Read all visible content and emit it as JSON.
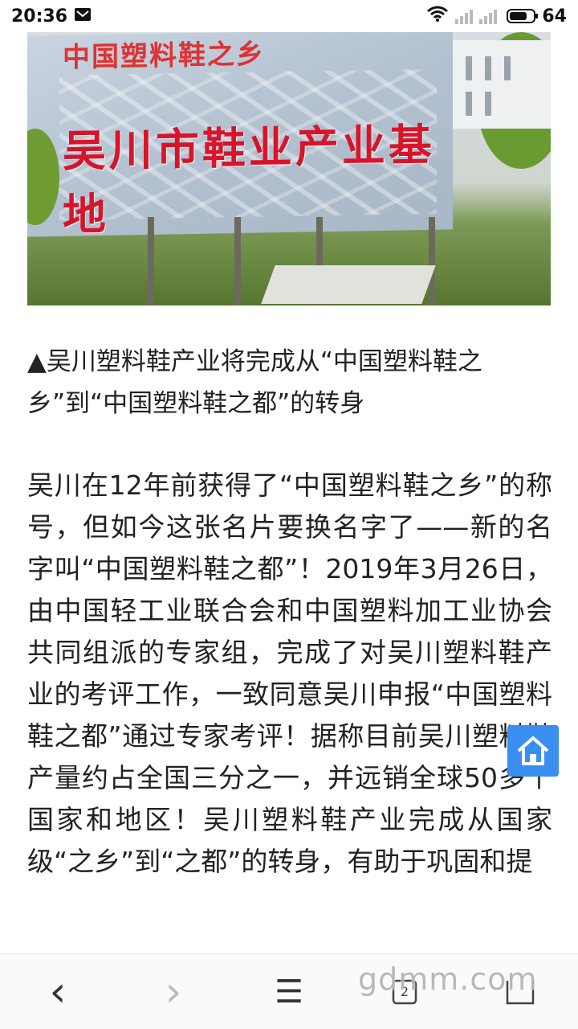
{
  "status_bar": {
    "time": "20:36",
    "battery": "64",
    "icons": [
      "message-icon",
      "wifi-icon",
      "signal-icon",
      "signal-icon",
      "battery-icon"
    ]
  },
  "photo": {
    "billboard_small": "中国塑料鞋之乡",
    "billboard_big": "吴川市鞋业产业基地"
  },
  "article": {
    "caption": "▲吴川塑料鞋产业将完成从“中国塑料鞋之乡”到“中国塑料鞋之都”的转身",
    "body": "吴川在12年前获得了“中国塑料鞋之乡”的称号，但如今这张名片要换名字了——新的名字叫“中国塑料鞋之都”！2019年3月26日，由中国轻工业联合会和中国塑料加工业协会共同组派的专家组，完成了对吴川塑料鞋产业的考评工作，一致同意吴川申报“中国塑料鞋之都”通过专家考评！据称目前吴川塑料鞋产量约占全国三分之一，并远销全球50多个国家和地区！吴川塑料鞋产业完成从国家级“之乡”到“之都”的转身，有助于巩固和提"
  },
  "bottom_nav": {
    "back": "‹",
    "forward": "›",
    "menu": "☰",
    "tabs_count": "2"
  },
  "watermark": "gdmm.com",
  "colors": {
    "home_button": "#3a8ef0",
    "billboard_text": "#d8142a"
  }
}
